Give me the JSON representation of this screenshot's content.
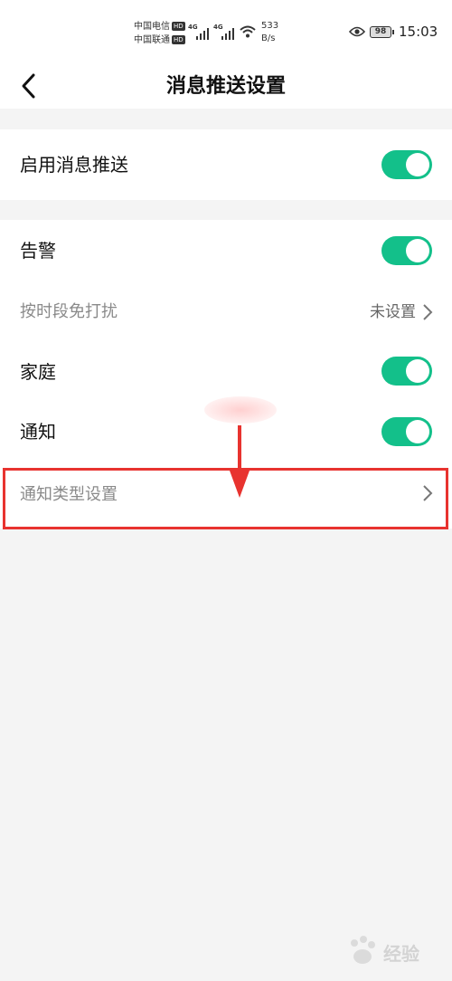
{
  "status_bar": {
    "carrier_1": "中国电信",
    "carrier_2": "中国联通",
    "hd": "HD",
    "network_1": "4G",
    "network_2": "4G",
    "speed_value": "533",
    "speed_unit": "B/s",
    "battery": "98",
    "time": "15:03"
  },
  "nav": {
    "title": "消息推送设置"
  },
  "section1": {
    "enable_push": {
      "label": "启用消息推送",
      "enabled": true
    }
  },
  "section2": {
    "alarm": {
      "label": "告警",
      "enabled": true
    },
    "dnd": {
      "label": "按时段免打扰",
      "value": "未设置"
    },
    "family": {
      "label": "家庭",
      "enabled": true
    },
    "notice": {
      "label": "通知",
      "enabled": true
    },
    "notice_type": {
      "label": "通知类型设置"
    }
  },
  "colors": {
    "toggle_on": "#13c08a",
    "annotation_red": "#e8332f"
  },
  "watermark": {
    "text": "经验",
    "logo": "baidu-paw-icon"
  }
}
